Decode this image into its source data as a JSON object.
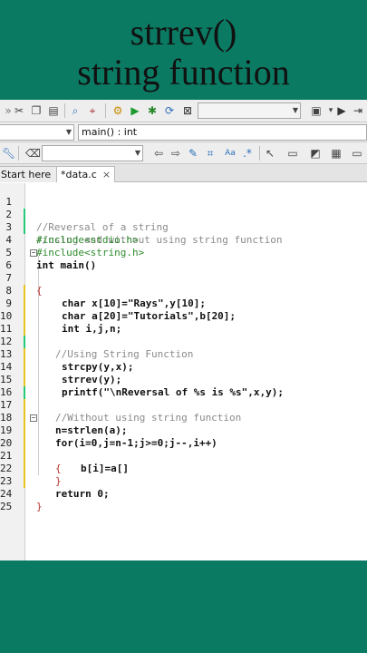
{
  "banner": {
    "line1": "strrev()",
    "line2": "string function"
  },
  "toolbar1": {
    "icons": [
      "scissors-icon",
      "copy-icon",
      "paste-icon",
      "find-icon",
      "replace-icon",
      "gear-icon",
      "run-icon",
      "debug-icon",
      "rebuild-icon",
      "stop-icon",
      "build-log-icon",
      "play-icon",
      "step-icon"
    ]
  },
  "toolbar2": {
    "function_combo": "main() : int"
  },
  "tabs": [
    {
      "label": "Start here",
      "close": "×"
    },
    {
      "label": "*data.c",
      "close": "×"
    }
  ],
  "code_lines": [
    {
      "n": "1",
      "text": "//Reversal of a string"
    },
    {
      "n": "2",
      "text": "//using and without using string function"
    },
    {
      "n": "3",
      "text": "#include<stdio.h>"
    },
    {
      "n": "4",
      "text": "#include<string.h>"
    },
    {
      "n": "5",
      "text": "int main()"
    },
    {
      "n": "6",
      "text": "{"
    },
    {
      "n": "7",
      "text": "char x[10]=\"Rays\",y[10];"
    },
    {
      "n": "8",
      "text": "char a[20]=\"Tutorials\",b[20];"
    },
    {
      "n": "9",
      "text": "int i,j,n;"
    },
    {
      "n": "10",
      "text": ""
    },
    {
      "n": "11",
      "text": "//Using String Function"
    },
    {
      "n": "12",
      "text": "strcpy(y,x);"
    },
    {
      "n": "13",
      "text": "strrev(y);"
    },
    {
      "n": "14",
      "text": "printf(\"\\nReversal of %s is %s\",x,y);"
    },
    {
      "n": "15",
      "text": ""
    },
    {
      "n": "16",
      "text": "//Without using string function"
    },
    {
      "n": "17",
      "text": "n=strlen(a);"
    },
    {
      "n": "18",
      "text": "for(i=0,j=n-1;j>=0;j--,i++)"
    },
    {
      "n": "19",
      "text": "{"
    },
    {
      "n": "20",
      "text": "b[i]=a[]"
    },
    {
      "n": "21",
      "text": "}"
    },
    {
      "n": "22",
      "text": ""
    },
    {
      "n": "23",
      "text": "return 0;"
    },
    {
      "n": "24",
      "text": "}"
    },
    {
      "n": "25",
      "text": ""
    }
  ],
  "colors": {
    "background": "#0b7a63",
    "comment": "#8a8a8a",
    "preprocessor": "#2e8b2e",
    "string": "#b0252f",
    "number": "#c0392b",
    "change_marker_saved": "#24c97b",
    "change_marker_modified": "#e8c420"
  }
}
